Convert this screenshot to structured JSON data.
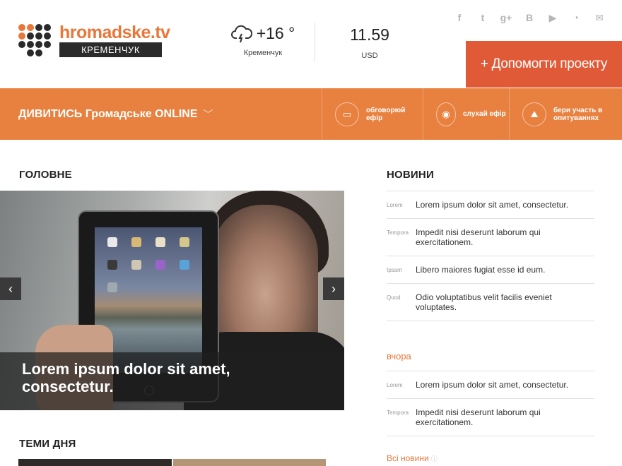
{
  "header": {
    "logo_text": "hromadske.tv",
    "logo_city": "КРЕМЕНЧУК",
    "weather": {
      "temp": "+16 °",
      "city": "Кременчук",
      "icon": "storm-cloud-icon"
    },
    "currency": {
      "value": "11.59",
      "label": "USD"
    },
    "social": [
      "facebook-icon",
      "twitter-icon",
      "google-plus-icon",
      "vk-icon",
      "youtube-icon",
      "rss-icon",
      "mail-icon"
    ],
    "social_glyphs": [
      "f",
      "t",
      "g+",
      "B",
      "▶",
      "◔",
      "✉"
    ],
    "help_button": "+ Допомогти проекту"
  },
  "nav": {
    "watch_label": "ДИВИТИСЬ Громадське ONLINE",
    "items": [
      {
        "label": "обговорюй ефір",
        "icon": "chat-icon",
        "glyph": "▭"
      },
      {
        "label": "слухай ефір",
        "icon": "broadcast-icon",
        "glyph": "◉"
      },
      {
        "label": "бери участь в опитуваннях",
        "icon": "poll-icon",
        "glyph": "⛰"
      }
    ]
  },
  "main": {
    "section_title": "ГОЛОВНЕ",
    "slide_caption": "Lorem ipsum dolor sit amet, consectetur.",
    "prev": "‹",
    "next": "›",
    "topics_title": "ТЕМИ ДНЯ"
  },
  "news": {
    "title": "НОВИНИ",
    "items": [
      {
        "tag": "Lorem",
        "text": "Lorem ipsum dolor sit amet, consectetur."
      },
      {
        "tag": "Tempora",
        "text": "Impedit nisi deserunt laborum qui exercitationem."
      },
      {
        "tag": "Ipsam",
        "text": "Libero maiores fugiat esse id eum."
      },
      {
        "tag": "Quod",
        "text": "Odio voluptatibus velit facilis eveniet voluptates."
      }
    ],
    "yesterday_label": "вчора",
    "yesterday_items": [
      {
        "tag": "Lorem",
        "text": "Lorem ipsum dolor sit amet, consectetur."
      },
      {
        "tag": "Tempora",
        "text": "Impedit nisi deserunt laborum qui exercitationem."
      }
    ],
    "all_news": "Всі новини"
  },
  "colors": {
    "accent": "#e8813f",
    "help": "#e05a37",
    "logo": "#e8773a"
  }
}
